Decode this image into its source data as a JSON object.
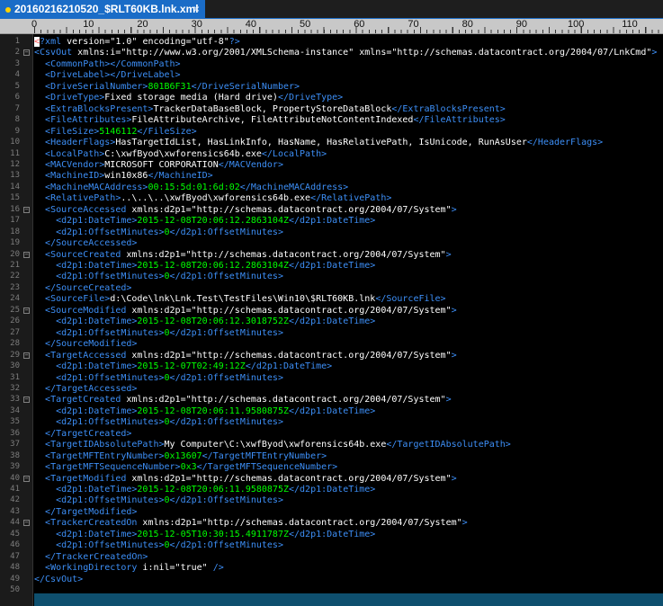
{
  "tab": {
    "title": "20160216210520_$RLT60KB.lnk.xml",
    "close": "×"
  },
  "ruler": {
    "labels": [
      "0",
      "10",
      "20",
      "30",
      "40",
      "50",
      "60",
      "70",
      "80",
      "90",
      "100",
      "110"
    ]
  },
  "lines": [
    [
      [
        "pi",
        "<"
      ],
      [
        "tag",
        "?xml "
      ],
      [
        "attr",
        "version="
      ],
      [
        "val",
        "\"1.0\" "
      ],
      [
        "attr",
        "encoding="
      ],
      [
        "val",
        "\"utf-8\""
      ],
      [
        "tag",
        "?>"
      ]
    ],
    [
      [
        "tag",
        "<CsvOut "
      ],
      [
        "attr",
        "xmlns:i="
      ],
      [
        "val",
        "\"http://www.w3.org/2001/XMLSchema-instance\" "
      ],
      [
        "attr",
        "xmlns="
      ],
      [
        "val",
        "\"http://schemas.datacontract.org/2004/07/LnkCmd\""
      ],
      [
        "tag",
        ">"
      ]
    ],
    [
      [
        "txt",
        "  "
      ],
      [
        "tag",
        "<CommonPath></CommonPath>"
      ]
    ],
    [
      [
        "txt",
        "  "
      ],
      [
        "tag",
        "<DriveLabel></DriveLabel>"
      ]
    ],
    [
      [
        "txt",
        "  "
      ],
      [
        "tag",
        "<DriveSerialNumber>"
      ],
      [
        "num",
        "801B6F31"
      ],
      [
        "tag",
        "</DriveSerialNumber>"
      ]
    ],
    [
      [
        "txt",
        "  "
      ],
      [
        "tag",
        "<DriveType>"
      ],
      [
        "txt",
        "Fixed storage media (Hard drive)"
      ],
      [
        "tag",
        "</DriveType>"
      ]
    ],
    [
      [
        "txt",
        "  "
      ],
      [
        "tag",
        "<ExtraBlocksPresent>"
      ],
      [
        "txt",
        "TrackerDataBaseBlock, PropertyStoreDataBlock"
      ],
      [
        "tag",
        "</ExtraBlocksPresent>"
      ]
    ],
    [
      [
        "txt",
        "  "
      ],
      [
        "tag",
        "<FileAttributes>"
      ],
      [
        "txt",
        "FileAttributeArchive, FileAttributeNotContentIndexed"
      ],
      [
        "tag",
        "</FileAttributes>"
      ]
    ],
    [
      [
        "txt",
        "  "
      ],
      [
        "tag",
        "<FileSize>"
      ],
      [
        "num",
        "5146112"
      ],
      [
        "tag",
        "</FileSize>"
      ]
    ],
    [
      [
        "txt",
        "  "
      ],
      [
        "tag",
        "<HeaderFlags>"
      ],
      [
        "txt",
        "HasTargetIdList, HasLinkInfo, HasName, HasRelativePath, IsUnicode, RunAsUser"
      ],
      [
        "tag",
        "</HeaderFlags>"
      ]
    ],
    [
      [
        "txt",
        "  "
      ],
      [
        "tag",
        "<LocalPath>"
      ],
      [
        "txt",
        "C:\\xwfByod\\xwforensics64b.exe"
      ],
      [
        "tag",
        "</LocalPath>"
      ]
    ],
    [
      [
        "txt",
        "  "
      ],
      [
        "tag",
        "<MACVendor>"
      ],
      [
        "txt",
        "MICROSOFT CORPORATION"
      ],
      [
        "tag",
        "</MACVendor>"
      ]
    ],
    [
      [
        "txt",
        "  "
      ],
      [
        "tag",
        "<MachineID>"
      ],
      [
        "txt",
        "win10x86"
      ],
      [
        "tag",
        "</MachineID>"
      ]
    ],
    [
      [
        "txt",
        "  "
      ],
      [
        "tag",
        "<MachineMACAddress>"
      ],
      [
        "num",
        "00:15:5d:01:6d:02"
      ],
      [
        "tag",
        "</MachineMACAddress>"
      ]
    ],
    [
      [
        "txt",
        "  "
      ],
      [
        "tag",
        "<RelativePath>"
      ],
      [
        "txt",
        "..\\..\\..\\xwfByod\\xwforensics64b.exe"
      ],
      [
        "tag",
        "</RelativePath>"
      ]
    ],
    [
      [
        "txt",
        "  "
      ],
      [
        "tag",
        "<SourceAccessed "
      ],
      [
        "attr",
        "xmlns:d2p1="
      ],
      [
        "val",
        "\"http://schemas.datacontract.org/2004/07/System\""
      ],
      [
        "tag",
        ">"
      ]
    ],
    [
      [
        "txt",
        "    "
      ],
      [
        "tag",
        "<d2p1:DateTime>"
      ],
      [
        "num",
        "2015-12-08T20:06:12.2863104Z"
      ],
      [
        "tag",
        "</d2p1:DateTime>"
      ]
    ],
    [
      [
        "txt",
        "    "
      ],
      [
        "tag",
        "<d2p1:OffsetMinutes>"
      ],
      [
        "num",
        "0"
      ],
      [
        "tag",
        "</d2p1:OffsetMinutes>"
      ]
    ],
    [
      [
        "txt",
        "  "
      ],
      [
        "tag",
        "</SourceAccessed>"
      ]
    ],
    [
      [
        "txt",
        "  "
      ],
      [
        "tag",
        "<SourceCreated "
      ],
      [
        "attr",
        "xmlns:d2p1="
      ],
      [
        "val",
        "\"http://schemas.datacontract.org/2004/07/System\""
      ],
      [
        "tag",
        ">"
      ]
    ],
    [
      [
        "txt",
        "    "
      ],
      [
        "tag",
        "<d2p1:DateTime>"
      ],
      [
        "num",
        "2015-12-08T20:06:12.2863104Z"
      ],
      [
        "tag",
        "</d2p1:DateTime>"
      ]
    ],
    [
      [
        "txt",
        "    "
      ],
      [
        "tag",
        "<d2p1:OffsetMinutes>"
      ],
      [
        "num",
        "0"
      ],
      [
        "tag",
        "</d2p1:OffsetMinutes>"
      ]
    ],
    [
      [
        "txt",
        "  "
      ],
      [
        "tag",
        "</SourceCreated>"
      ]
    ],
    [
      [
        "txt",
        "  "
      ],
      [
        "tag",
        "<SourceFile>"
      ],
      [
        "txt",
        "d:\\Code\\lnk\\Lnk.Test\\TestFiles\\Win10\\$RLT60KB.lnk"
      ],
      [
        "tag",
        "</SourceFile>"
      ]
    ],
    [
      [
        "txt",
        "  "
      ],
      [
        "tag",
        "<SourceModified "
      ],
      [
        "attr",
        "xmlns:d2p1="
      ],
      [
        "val",
        "\"http://schemas.datacontract.org/2004/07/System\""
      ],
      [
        "tag",
        ">"
      ]
    ],
    [
      [
        "txt",
        "    "
      ],
      [
        "tag",
        "<d2p1:DateTime>"
      ],
      [
        "num",
        "2015-12-08T20:06:12.3018752Z"
      ],
      [
        "tag",
        "</d2p1:DateTime>"
      ]
    ],
    [
      [
        "txt",
        "    "
      ],
      [
        "tag",
        "<d2p1:OffsetMinutes>"
      ],
      [
        "num",
        "0"
      ],
      [
        "tag",
        "</d2p1:OffsetMinutes>"
      ]
    ],
    [
      [
        "txt",
        "  "
      ],
      [
        "tag",
        "</SourceModified>"
      ]
    ],
    [
      [
        "txt",
        "  "
      ],
      [
        "tag",
        "<TargetAccessed "
      ],
      [
        "attr",
        "xmlns:d2p1="
      ],
      [
        "val",
        "\"http://schemas.datacontract.org/2004/07/System\""
      ],
      [
        "tag",
        ">"
      ]
    ],
    [
      [
        "txt",
        "    "
      ],
      [
        "tag",
        "<d2p1:DateTime>"
      ],
      [
        "num",
        "2015-12-07T02:49:12Z"
      ],
      [
        "tag",
        "</d2p1:DateTime>"
      ]
    ],
    [
      [
        "txt",
        "    "
      ],
      [
        "tag",
        "<d2p1:OffsetMinutes>"
      ],
      [
        "num",
        "0"
      ],
      [
        "tag",
        "</d2p1:OffsetMinutes>"
      ]
    ],
    [
      [
        "txt",
        "  "
      ],
      [
        "tag",
        "</TargetAccessed>"
      ]
    ],
    [
      [
        "txt",
        "  "
      ],
      [
        "tag",
        "<TargetCreated "
      ],
      [
        "attr",
        "xmlns:d2p1="
      ],
      [
        "val",
        "\"http://schemas.datacontract.org/2004/07/System\""
      ],
      [
        "tag",
        ">"
      ]
    ],
    [
      [
        "txt",
        "    "
      ],
      [
        "tag",
        "<d2p1:DateTime>"
      ],
      [
        "num",
        "2015-12-08T20:06:11.9580875Z"
      ],
      [
        "tag",
        "</d2p1:DateTime>"
      ]
    ],
    [
      [
        "txt",
        "    "
      ],
      [
        "tag",
        "<d2p1:OffsetMinutes>"
      ],
      [
        "num",
        "0"
      ],
      [
        "tag",
        "</d2p1:OffsetMinutes>"
      ]
    ],
    [
      [
        "txt",
        "  "
      ],
      [
        "tag",
        "</TargetCreated>"
      ]
    ],
    [
      [
        "txt",
        "  "
      ],
      [
        "tag",
        "<TargetIDAbsolutePath>"
      ],
      [
        "txt",
        "My Computer\\C:\\xwfByod\\xwforensics64b.exe"
      ],
      [
        "tag",
        "</TargetIDAbsolutePath>"
      ]
    ],
    [
      [
        "txt",
        "  "
      ],
      [
        "tag",
        "<TargetMFTEntryNumber>"
      ],
      [
        "num",
        "0x13607"
      ],
      [
        "tag",
        "</TargetMFTEntryNumber>"
      ]
    ],
    [
      [
        "txt",
        "  "
      ],
      [
        "tag",
        "<TargetMFTSequenceNumber>"
      ],
      [
        "num",
        "0x3"
      ],
      [
        "tag",
        "</TargetMFTSequenceNumber>"
      ]
    ],
    [
      [
        "txt",
        "  "
      ],
      [
        "tag",
        "<TargetModified "
      ],
      [
        "attr",
        "xmlns:d2p1="
      ],
      [
        "val",
        "\"http://schemas.datacontract.org/2004/07/System\""
      ],
      [
        "tag",
        ">"
      ]
    ],
    [
      [
        "txt",
        "    "
      ],
      [
        "tag",
        "<d2p1:DateTime>"
      ],
      [
        "num",
        "2015-12-08T20:06:11.9580875Z"
      ],
      [
        "tag",
        "</d2p1:DateTime>"
      ]
    ],
    [
      [
        "txt",
        "    "
      ],
      [
        "tag",
        "<d2p1:OffsetMinutes>"
      ],
      [
        "num",
        "0"
      ],
      [
        "tag",
        "</d2p1:OffsetMinutes>"
      ]
    ],
    [
      [
        "txt",
        "  "
      ],
      [
        "tag",
        "</TargetModified>"
      ]
    ],
    [
      [
        "txt",
        "  "
      ],
      [
        "tag",
        "<TrackerCreatedOn "
      ],
      [
        "attr",
        "xmlns:d2p1="
      ],
      [
        "val",
        "\"http://schemas.datacontract.org/2004/07/System\""
      ],
      [
        "tag",
        ">"
      ]
    ],
    [
      [
        "txt",
        "    "
      ],
      [
        "tag",
        "<d2p1:DateTime>"
      ],
      [
        "num",
        "2015-12-05T10:30:15.4911787Z"
      ],
      [
        "tag",
        "</d2p1:DateTime>"
      ]
    ],
    [
      [
        "txt",
        "    "
      ],
      [
        "tag",
        "<d2p1:OffsetMinutes>"
      ],
      [
        "num",
        "0"
      ],
      [
        "tag",
        "</d2p1:OffsetMinutes>"
      ]
    ],
    [
      [
        "txt",
        "  "
      ],
      [
        "tag",
        "</TrackerCreatedOn>"
      ]
    ],
    [
      [
        "txt",
        "  "
      ],
      [
        "tag",
        "<WorkingDirectory "
      ],
      [
        "attr",
        "i:nil="
      ],
      [
        "val",
        "\"true\" "
      ],
      [
        "tag",
        "/>"
      ]
    ],
    [
      [
        "tag",
        "</CsvOut>"
      ]
    ],
    [
      [
        "txt",
        ""
      ]
    ]
  ],
  "folds": [
    2,
    16,
    20,
    25,
    29,
    33,
    40,
    44
  ],
  "colors": {
    "tag": "#3d8ff7",
    "number": "#00ff00",
    "text": "#ffffff",
    "background": "#000000",
    "tab": "#1a6cc7"
  }
}
